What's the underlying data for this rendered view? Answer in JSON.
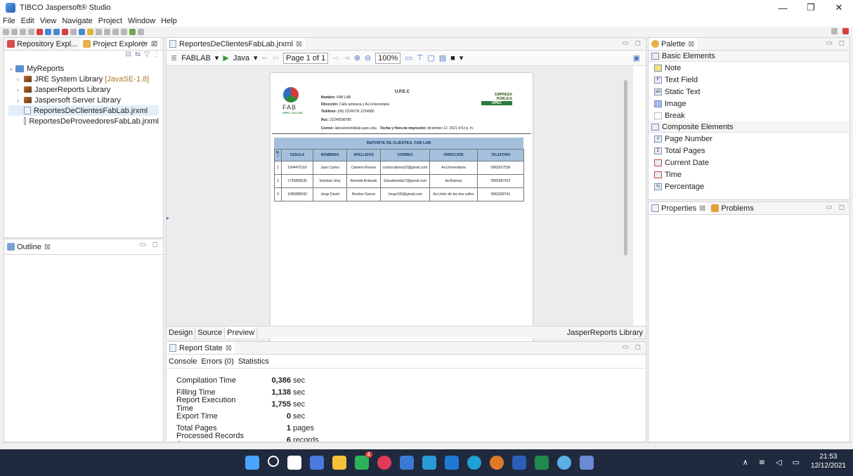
{
  "window": {
    "title": "TIBCO Jaspersoft® Studio",
    "minimize": "—",
    "restore": "❐",
    "close": "✕"
  },
  "menu": [
    "File",
    "Edit",
    "View",
    "Navigate",
    "Project",
    "Window",
    "Help"
  ],
  "left_tabs": {
    "repo": "Repository Expl...",
    "project": "Project Explorer"
  },
  "tree": {
    "root": "MyReports",
    "items": [
      {
        "label": "JRE System Library",
        "suffix": "[JavaSE-1.8]"
      },
      {
        "label": "JasperReports Library",
        "suffix": ""
      },
      {
        "label": "Jaspersoft Server Library",
        "suffix": ""
      },
      {
        "label": "ReportesDeClientesFabLab.jrxml",
        "suffix": ""
      },
      {
        "label": "ReportesDeProveedoresFabLab.jrxml",
        "suffix": ""
      }
    ]
  },
  "outline": {
    "title": "Outline"
  },
  "editor": {
    "tab": "ReportesDeClientesFabLab.jrxml",
    "adapter": "FABLAB",
    "lang": "Java",
    "page_label": "Page 1 of 1",
    "zoom": "100%",
    "bottom_tabs": [
      "Design",
      "Source",
      "Preview"
    ],
    "library": "JasperReports Library"
  },
  "report": {
    "org": "U.P.E.C",
    "nombre_label": "Nombre:",
    "nombre": "FAB LAB",
    "direccion_label": "Dirección:",
    "direccion": "Calle antisana y Av.Universitaria",
    "telefono_label": "Teléfono:",
    "telefono": "(06) 2224079/ 2224080",
    "ruc_label": "Ruc:",
    "ruc": "22245598785",
    "correo_label": "Correo:",
    "correo": "laboratoriofablab.upec.edu.",
    "fecha_label": "Fecha y Hora de impresión:",
    "fecha": "diciembre 12, 2021  9:53 p. m.",
    "logo_left": "FAB",
    "logo_left2": "UPEC TULCÁN",
    "logo_right1": "EMPRESA",
    "logo_right2": "PÚBLICA",
    "logo_right3": "UPEC",
    "report_title": "REPORTE DE CLIENTES- FAB LAB",
    "headers": [
      "N.°",
      "CEDULA",
      "NOMBRES",
      "APELLIDOS",
      "CORREO",
      "DIRECCIÓN",
      "TELEFONO"
    ],
    "rows": [
      [
        "1",
        "1004470116",
        "Juan Carlos",
        "Cabrera Rosero",
        "carloscabrera23@gmail.com",
        "Av.Universitaria",
        "0963527536"
      ],
      [
        "2",
        "1725869535",
        "Soledad Jeny",
        "Almeida Andrade",
        "Solealmeida17@gmail.com",
        "Av.Bulevar",
        "0965587422"
      ],
      [
        "3",
        "1005886592",
        "Jorge David",
        "Benitez Garcia",
        "Jorge100@gmail.com",
        "Av.Unión de las dos calles",
        "0963258741"
      ]
    ]
  },
  "palette": {
    "title": "Palette",
    "basic": "Basic Elements",
    "basic_items": [
      "Note",
      "Text Field",
      "Static Text",
      "Image",
      "Break"
    ],
    "composite": "Composite Elements",
    "composite_items": [
      "Page Number",
      "Total Pages",
      "Current Date",
      "Time",
      "Percentage"
    ]
  },
  "properties": {
    "title": "Properties",
    "problems": "Problems"
  },
  "report_state": {
    "title": "Report State",
    "tabs": [
      "Console",
      "Errors (0)",
      "Statistics"
    ],
    "stats": [
      {
        "label": "Compilation Time",
        "value": "0,386",
        "unit": "sec"
      },
      {
        "label": "Filling Time",
        "value": "1,138",
        "unit": "sec"
      },
      {
        "label": "Report Execution Time",
        "value": "1,755",
        "unit": "sec"
      },
      {
        "label": "Export Time",
        "value": "0",
        "unit": "sec"
      },
      {
        "label": "Total Pages",
        "value": "1",
        "unit": "pages"
      },
      {
        "label": "Processed Records Count",
        "value": "6",
        "unit": "records"
      }
    ]
  },
  "taskbar": {
    "time": "21:53",
    "date": "12/12/2021",
    "badge": "4"
  }
}
